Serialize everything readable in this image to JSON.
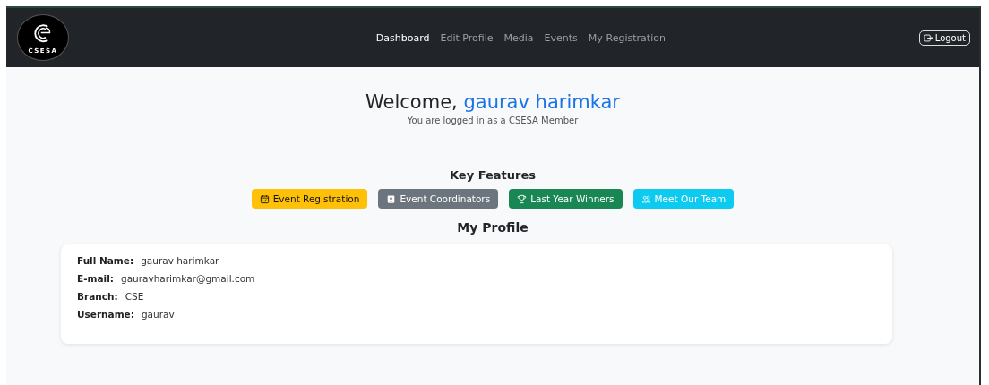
{
  "logo": {
    "text": "CSESA"
  },
  "nav": [
    {
      "label": "Dashboard",
      "selected": true
    },
    {
      "label": "Edit Profile",
      "selected": false
    },
    {
      "label": "Media",
      "selected": false
    },
    {
      "label": "Events",
      "selected": false
    },
    {
      "label": "My-Registration",
      "selected": false
    }
  ],
  "logout": {
    "label": "Logout"
  },
  "welcome": {
    "greeting": "Welcome,",
    "name": "gaurav harimkar",
    "subtitle": "You are logged in as a CSESA Member"
  },
  "key_features": {
    "title": "Key Features",
    "buttons": [
      {
        "label": "Event Registration",
        "kind": "calendar",
        "color": "#ffc107"
      },
      {
        "label": "Event Coordinators",
        "kind": "badge",
        "color": "#6c757d"
      },
      {
        "label": "Last Year Winners",
        "kind": "trophy",
        "color": "#198754"
      },
      {
        "label": "Meet Our Team",
        "kind": "people",
        "color": "#0dcaf0"
      }
    ]
  },
  "profile": {
    "title": "My Profile",
    "fields": [
      {
        "label": "Full Name:",
        "value": "gaurav harimkar"
      },
      {
        "label": "E-mail:",
        "value": "gauravharimkar@gmail.com"
      },
      {
        "label": "Branch:",
        "value": "CSE"
      },
      {
        "label": "Username:",
        "value": "gaurav"
      }
    ]
  }
}
